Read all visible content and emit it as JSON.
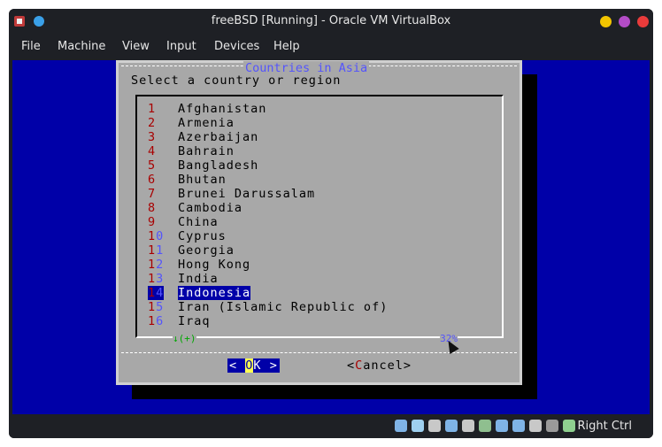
{
  "window": {
    "title": "freeBSD [Running] - Oracle VM VirtualBox",
    "buttons": [
      {
        "name": "minimize",
        "color": "#f2c500"
      },
      {
        "name": "maximize",
        "color": "#b34cc7"
      },
      {
        "name": "close",
        "color": "#e93b3b"
      }
    ]
  },
  "menubar": {
    "items": [
      "File",
      "Machine",
      "View",
      "Input",
      "Devices",
      "Help"
    ]
  },
  "dialog": {
    "title": "Countries in Asia",
    "prompt": "Select a country or region",
    "items": [
      {
        "num_a": "1",
        "num_b": "",
        "label": "Afghanistan"
      },
      {
        "num_a": "2",
        "num_b": "",
        "label": "Armenia"
      },
      {
        "num_a": "3",
        "num_b": "",
        "label": "Azerbaijan"
      },
      {
        "num_a": "4",
        "num_b": "",
        "label": "Bahrain"
      },
      {
        "num_a": "5",
        "num_b": "",
        "label": "Bangladesh"
      },
      {
        "num_a": "6",
        "num_b": "",
        "label": "Bhutan"
      },
      {
        "num_a": "7",
        "num_b": "",
        "label": "Brunei Darussalam"
      },
      {
        "num_a": "8",
        "num_b": "",
        "label": "Cambodia"
      },
      {
        "num_a": "9",
        "num_b": "",
        "label": "China"
      },
      {
        "num_a": "1",
        "num_b": "0",
        "label": "Cyprus"
      },
      {
        "num_a": "1",
        "num_b": "1",
        "label": "Georgia"
      },
      {
        "num_a": "1",
        "num_b": "2",
        "label": "Hong Kong"
      },
      {
        "num_a": "1",
        "num_b": "3",
        "label": "India"
      },
      {
        "num_a": "1",
        "num_b": "4",
        "label": "Indonesia",
        "selected": true
      },
      {
        "num_a": "1",
        "num_b": "5",
        "label": "Iran (Islamic Republic of)"
      },
      {
        "num_a": "1",
        "num_b": "6",
        "label": "Iraq"
      }
    ],
    "more_indicator": "↓(+)",
    "scroll_percent": "32%",
    "ok": {
      "left": "<",
      "hot": "O",
      "rest": "K",
      "right": ">"
    },
    "cancel": {
      "left": "<",
      "hot": "C",
      "rest": "ancel",
      "right": ">"
    }
  },
  "statusbar": {
    "icons": [
      "hard-disk-icon",
      "optical-drive-icon",
      "audio-icon",
      "network-icon",
      "usb-icon",
      "shared-folders-icon",
      "display-icon",
      "video-capture-icon",
      "cpu-icon",
      "mouse-integration-icon",
      "keyboard-capture-icon"
    ],
    "host_key": "Right Ctrl"
  }
}
